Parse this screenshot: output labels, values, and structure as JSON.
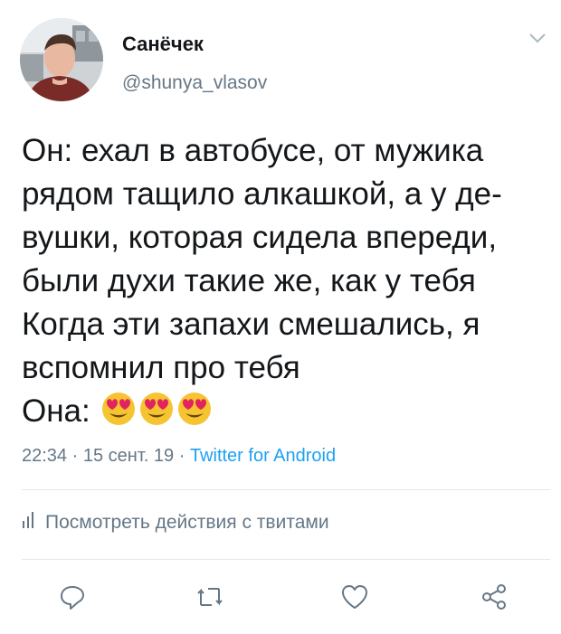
{
  "author": {
    "display_name": "Санёчек",
    "handle": "@shunya_vlasov"
  },
  "tweet": {
    "text": "Он: ехал в автобусе, от мужика\nрядом тащило алкашкой, а у де-\nвушки, которая сидела впереди,\nбыли духи такие же, как у тебя\nКогда эти запахи смешались, я\nвспомнил про тебя\nОна: ",
    "emoji": [
      "heart-eyes-emoji",
      "heart-eyes-emoji",
      "heart-eyes-emoji"
    ],
    "time": "22:34",
    "date": "15 сент. 19",
    "source": "Twitter for Android",
    "separator": "·"
  },
  "activity": {
    "label": "Посмотреть действия с твитами",
    "icon": "bar-chart-icon"
  },
  "actions": [
    {
      "name": "reply",
      "icon": "reply-icon"
    },
    {
      "name": "retweet",
      "icon": "retweet-icon"
    },
    {
      "name": "like",
      "icon": "heart-icon"
    },
    {
      "name": "share",
      "icon": "share-icon"
    }
  ],
  "colors": {
    "text": "#14171a",
    "secondary": "#657786",
    "link": "#1da1f2",
    "divider": "#e1e8ed",
    "emoji_face": "#f6c431",
    "emoji_heart": "#e0245e"
  }
}
